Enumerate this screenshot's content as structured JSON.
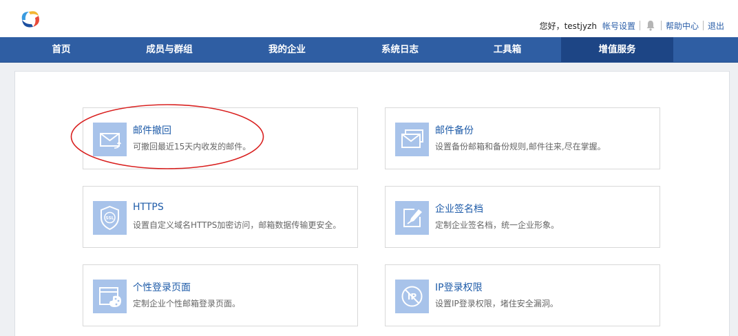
{
  "header": {
    "greeting": "您好，testjyzh",
    "account_settings": "帐号设置",
    "help_center": "帮助中心",
    "logout": "退出",
    "bell_icon": "bell-icon"
  },
  "nav": {
    "items": [
      {
        "label": "首页"
      },
      {
        "label": "成员与群组"
      },
      {
        "label": "我的企业"
      },
      {
        "label": "系统日志"
      },
      {
        "label": "工具箱"
      },
      {
        "label": "增值服务",
        "active": true
      }
    ]
  },
  "services": [
    {
      "title": "邮件撤回",
      "desc": "可撤回最近15天内收发的邮件。",
      "icon": "mail-recall-icon"
    },
    {
      "title": "邮件备份",
      "desc": "设置备份邮箱和备份规则,邮件往来,尽在掌握。",
      "icon": "mail-backup-icon"
    },
    {
      "title": "HTTPS",
      "desc": "设置自定义域名HTTPS加密访问，邮箱数据传输更安全。",
      "icon": "ssl-shield-icon"
    },
    {
      "title": "企业签名档",
      "desc": "定制企业签名档，统一企业形象。",
      "icon": "signature-pen-icon"
    },
    {
      "title": "个性登录页面",
      "desc": "定制企业个性邮箱登录页面。",
      "icon": "login-page-palette-icon"
    },
    {
      "title": "IP登录权限",
      "desc": "设置IP登录权限，堵住安全漏洞。",
      "icon": "ip-restrict-icon"
    }
  ],
  "colors": {
    "nav_bg": "#2f5ea3",
    "nav_active": "#1d4585",
    "icon_bg": "#a8c3ea",
    "link": "#1e5ba8",
    "annotation": "#d9201f"
  }
}
